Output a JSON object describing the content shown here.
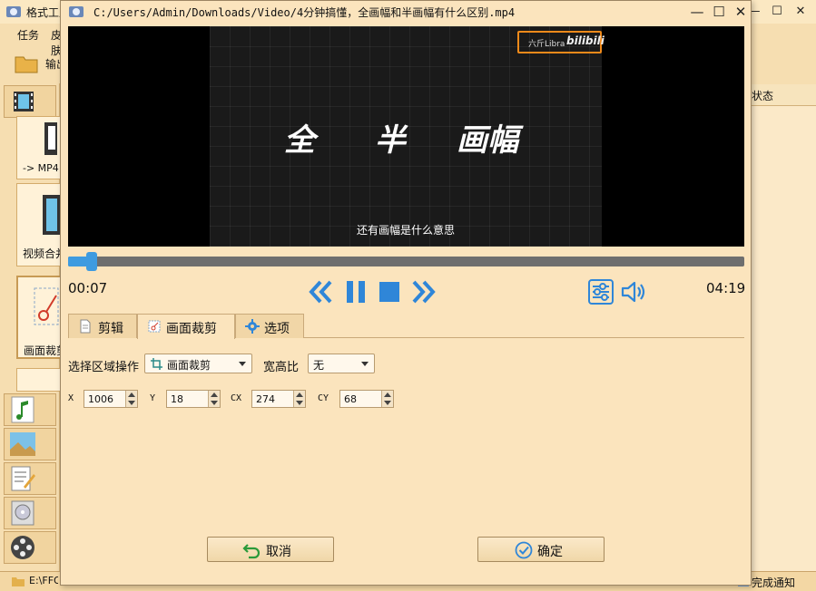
{
  "main_window": {
    "title": "格式工厂",
    "menu": [
      "任务",
      "皮肤"
    ],
    "toolbar_label": "输出文件夹",
    "tool_cards": [
      "-> MP4",
      "视频合并",
      "画面裁剪"
    ],
    "status_column": "状态",
    "statusbar_path": "E:\\FFOutput",
    "statusbar_notice": "完成通知"
  },
  "dialog": {
    "title": "C:/Users/Admin/Downloads/Video/4分钟搞懂，全画幅和半画幅有什么区别.mp4"
  },
  "video": {
    "watermark_text": "六斤Libra",
    "watermark_logo": "bilibili",
    "words": [
      "全",
      "半",
      "画幅"
    ],
    "subtitle": "还有画幅是什么意思",
    "highlight_color": "#f08a1a"
  },
  "player": {
    "current_time": "00:07",
    "total_time": "04:19",
    "progress_fraction": 0.027,
    "accent_color": "#3e9be0",
    "controls": [
      "rewind-icon",
      "pause-icon",
      "stop-icon",
      "fast-forward-icon",
      "settings-sliders-icon",
      "volume-icon"
    ]
  },
  "tabs": [
    {
      "label": "剪辑",
      "icon": "document-icon"
    },
    {
      "label": "画面裁剪",
      "icon": "crop-icon",
      "active": true
    },
    {
      "label": "选项",
      "icon": "gear-icon"
    }
  ],
  "crop": {
    "select_label": "选择区域操作",
    "select_value": "画面裁剪",
    "ratio_label": "宽高比",
    "ratio_value": "无",
    "fields": [
      {
        "label": "X",
        "value": "1006"
      },
      {
        "label": "Y",
        "value": "18"
      },
      {
        "label": "CX",
        "value": "274"
      },
      {
        "label": "CY",
        "value": "68"
      }
    ]
  },
  "buttons": {
    "cancel": "取消",
    "ok": "确定"
  }
}
